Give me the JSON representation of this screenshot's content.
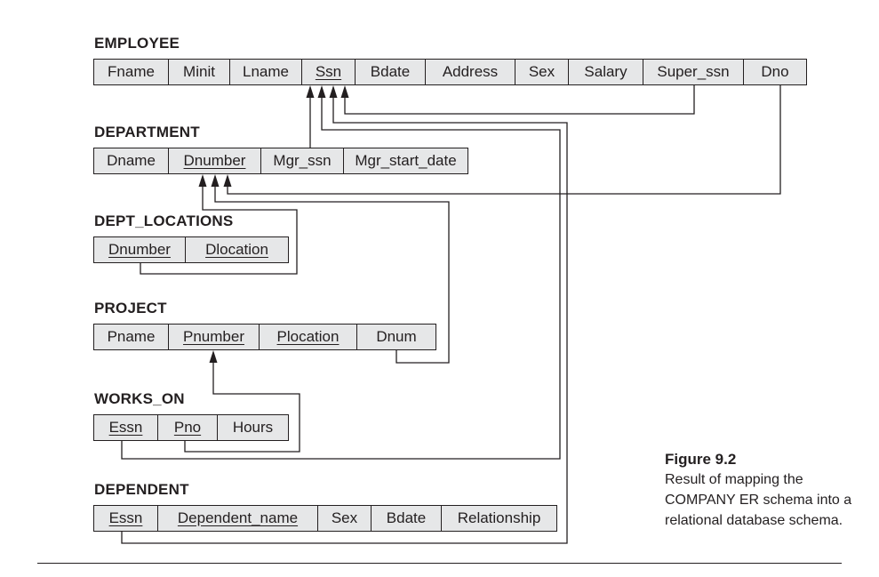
{
  "diagram": {
    "relations": [
      {
        "name": "EMPLOYEE",
        "attributes": [
          {
            "label": "Fname",
            "key": false
          },
          {
            "label": "Minit",
            "key": false
          },
          {
            "label": "Lname",
            "key": false
          },
          {
            "label": "Ssn",
            "key": true
          },
          {
            "label": "Bdate",
            "key": false
          },
          {
            "label": "Address",
            "key": false
          },
          {
            "label": "Sex",
            "key": false
          },
          {
            "label": "Salary",
            "key": false
          },
          {
            "label": "Super_ssn",
            "key": false
          },
          {
            "label": "Dno",
            "key": false
          }
        ]
      },
      {
        "name": "DEPARTMENT",
        "attributes": [
          {
            "label": "Dname",
            "key": false
          },
          {
            "label": "Dnumber",
            "key": true
          },
          {
            "label": "Mgr_ssn",
            "key": false
          },
          {
            "label": "Mgr_start_date",
            "key": false
          }
        ]
      },
      {
        "name": "DEPT_LOCATIONS",
        "attributes": [
          {
            "label": "Dnumber",
            "key": true
          },
          {
            "label": "Dlocation",
            "key": true
          }
        ]
      },
      {
        "name": "PROJECT",
        "attributes": [
          {
            "label": "Pname",
            "key": false
          },
          {
            "label": "Pnumber",
            "key": true
          },
          {
            "label": "Plocation",
            "key": true
          },
          {
            "label": "Dnum",
            "key": false
          }
        ]
      },
      {
        "name": "WORKS_ON",
        "attributes": [
          {
            "label": "Essn",
            "key": true
          },
          {
            "label": "Pno",
            "key": true
          },
          {
            "label": "Hours",
            "key": false
          }
        ]
      },
      {
        "name": "DEPENDENT",
        "attributes": [
          {
            "label": "Essn",
            "key": true
          },
          {
            "label": "Dependent_name",
            "key": true
          },
          {
            "label": "Sex",
            "key": false
          },
          {
            "label": "Bdate",
            "key": false
          },
          {
            "label": "Relationship",
            "key": false
          }
        ]
      }
    ],
    "foreign_keys": [
      {
        "from": "EMPLOYEE.Super_ssn",
        "to": "EMPLOYEE.Ssn"
      },
      {
        "from": "EMPLOYEE.Dno",
        "to": "DEPARTMENT.Dnumber"
      },
      {
        "from": "DEPARTMENT.Mgr_ssn",
        "to": "EMPLOYEE.Ssn"
      },
      {
        "from": "DEPT_LOCATIONS.Dnumber",
        "to": "DEPARTMENT.Dnumber"
      },
      {
        "from": "PROJECT.Dnum",
        "to": "DEPARTMENT.Dnumber"
      },
      {
        "from": "WORKS_ON.Essn",
        "to": "EMPLOYEE.Ssn"
      },
      {
        "from": "WORKS_ON.Pno",
        "to": "PROJECT.Pnumber"
      },
      {
        "from": "DEPENDENT.Essn",
        "to": "EMPLOYEE.Ssn"
      }
    ]
  },
  "caption": {
    "figure_label": "Figure 9.2",
    "text": "Result of mapping the COMPANY ER schema into a relational database schema."
  }
}
